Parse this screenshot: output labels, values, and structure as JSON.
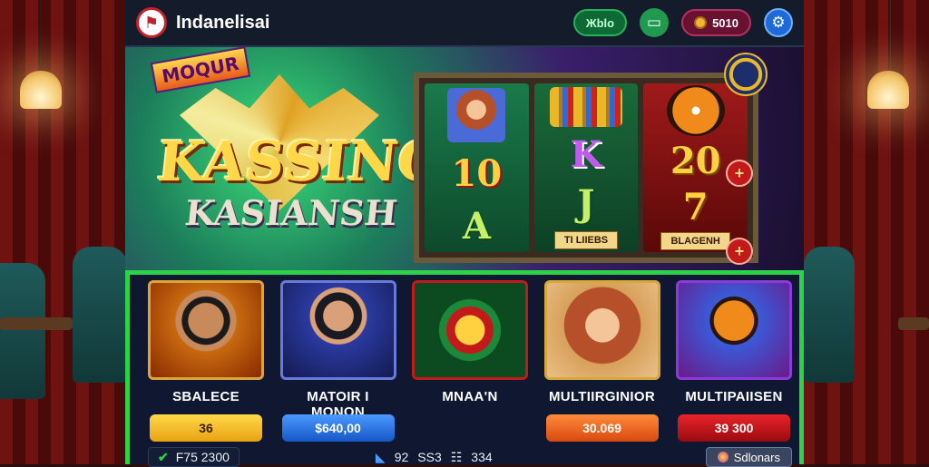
{
  "header": {
    "app_title": "Indanelisai",
    "logo_icon": "flag-logo-icon",
    "pill_green_label": "Жblo",
    "wallet_icon": "wallet-icon",
    "coin_balance": "5010",
    "settings_icon": "gear-icon"
  },
  "hero": {
    "brand_tag": "MOQUR",
    "title_line1": "KASSINO",
    "title_line2": "KASIANSH",
    "reels": [
      {
        "top_icon": "woman-portrait",
        "symbol1": "10",
        "symbol2": "A"
      },
      {
        "top_icon": "chip-stack",
        "symbol1": "K",
        "symbol2": "J",
        "ribbon": "TI LIIEBS"
      },
      {
        "top_icon": "tiger",
        "symbol1": "20",
        "symbol2": "7",
        "ribbon": "BLAGENH"
      }
    ],
    "plus_icon": "plus-icon",
    "medal_icon": "medal-icon"
  },
  "lobby": {
    "games": [
      {
        "name": "SBALECE",
        "amount": "36",
        "icon": "man-portrait"
      },
      {
        "name": "MATOIR I MONON",
        "amount": "$640,00",
        "icon": "dealer-with-chips"
      },
      {
        "name": "MNAA'N",
        "amount": "",
        "icon": "roulette-wheel"
      },
      {
        "name": "MULTIIRGINIOR",
        "amount": "30.069",
        "icon": "woman-portrait"
      },
      {
        "name": "MULTIPAIISEN",
        "amount": "39 300",
        "icon": "tiger-pagion"
      }
    ],
    "status": {
      "left_value": "F75 2300",
      "mid_value_1": "92",
      "mid_value_2": "SS3",
      "mid_value_3": "334",
      "dollars_label": "Sdlonars"
    }
  },
  "colors": {
    "lobby_border": "#2ed14a",
    "topbar_bg": "#141b2b",
    "accent_red": "#c21a1a"
  }
}
